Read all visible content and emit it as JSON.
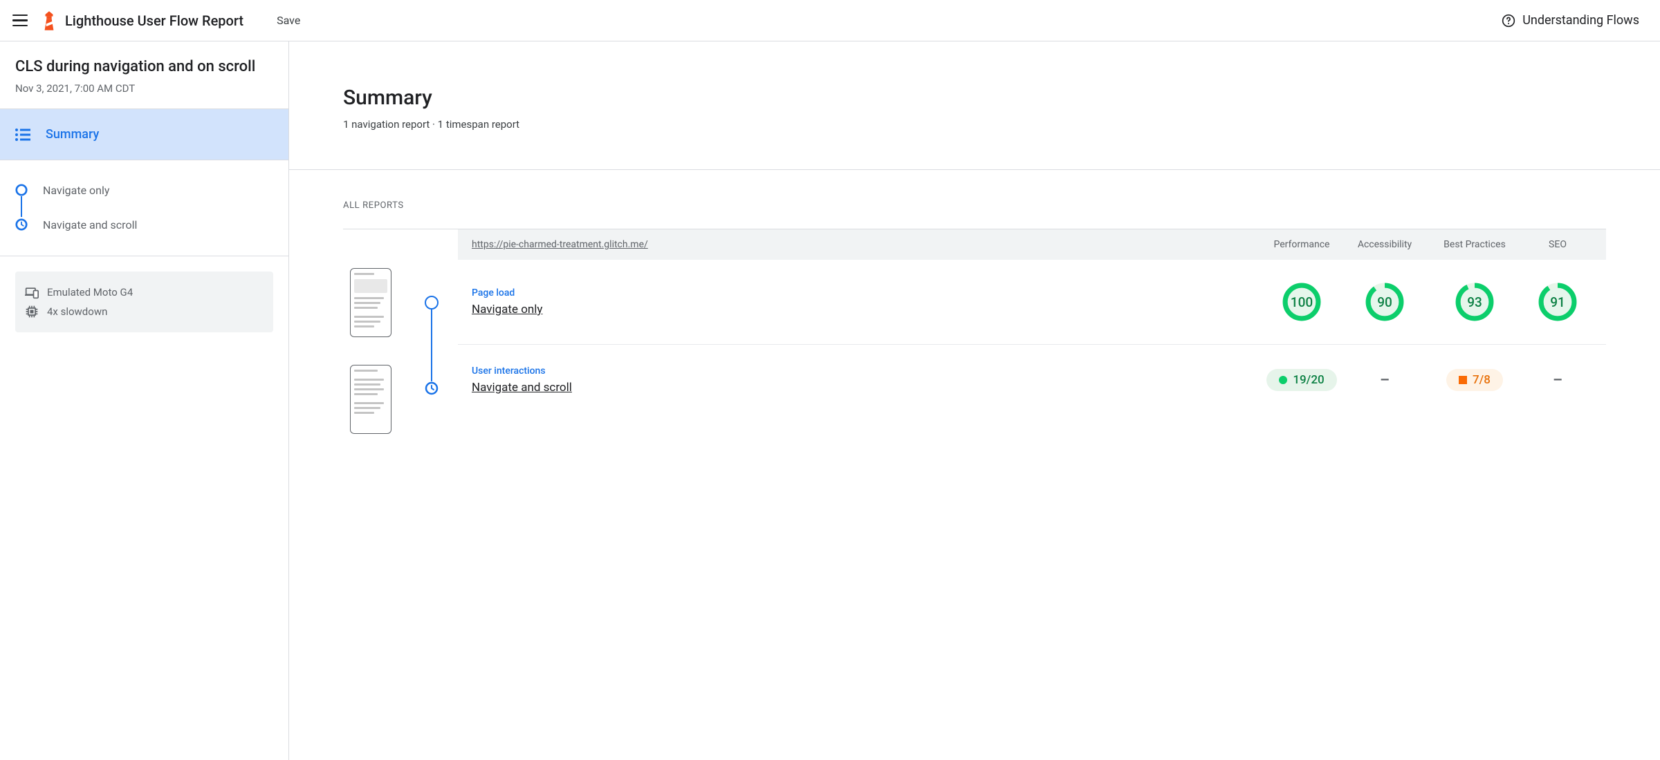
{
  "topbar": {
    "title": "Lighthouse User Flow Report",
    "save_label": "Save",
    "help_label": "Understanding Flows"
  },
  "sidebar": {
    "title": "CLS during navigation and on scroll",
    "date": "Nov 3, 2021, 7:00 AM CDT",
    "summary_label": "Summary",
    "steps": [
      {
        "label": "Navigate only",
        "icon": "circle"
      },
      {
        "label": "Navigate and scroll",
        "icon": "clock"
      }
    ],
    "settings": {
      "device": "Emulated Moto G4",
      "throttling": "4x slowdown"
    }
  },
  "main": {
    "title": "Summary",
    "subtitle": "1 navigation report · 1 timespan report",
    "reports_heading": "ALL REPORTS",
    "table": {
      "url": "https://pie-charmed-treatment.glitch.me/",
      "columns": {
        "performance": "Performance",
        "accessibility": "Accessibility",
        "best_practices": "Best Practices",
        "seo": "SEO"
      },
      "rows": [
        {
          "category": "Page load",
          "name": "Navigate only",
          "scores": {
            "performance": "100",
            "accessibility": "90",
            "best_practices": "93",
            "seo": "91"
          },
          "type": "gauge"
        },
        {
          "category": "User interactions",
          "name": "Navigate and scroll",
          "scores": {
            "performance": "19/20",
            "accessibility": "–",
            "best_practices": "7/8",
            "seo": "–"
          },
          "type": "pill"
        }
      ]
    }
  }
}
